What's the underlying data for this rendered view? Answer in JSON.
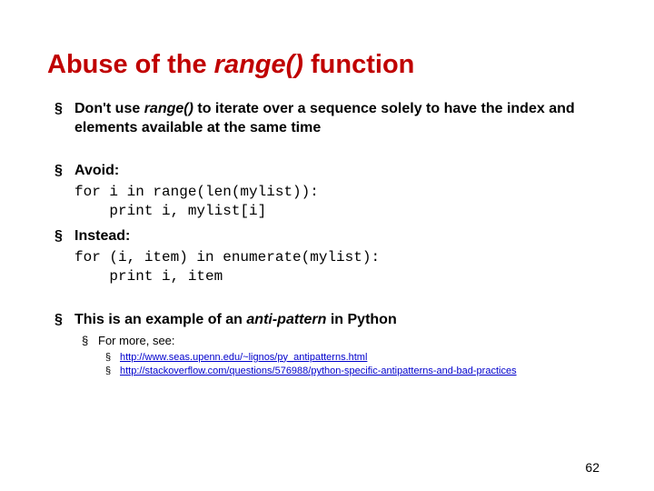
{
  "title_pre": "Abuse of the ",
  "title_fn": "range()",
  "title_post": " function",
  "bullet1_pre": "Don't use ",
  "bullet1_fn": "range()",
  "bullet1_post": " to iterate over a sequence solely to have the index and elements available at the same time",
  "avoid_label": "Avoid:",
  "avoid_code": "for i in range(len(mylist)):\n    print i, mylist[i]",
  "instead_label": "Instead:",
  "instead_code": "for (i, item) in enumerate(mylist):\n    print i, item",
  "antipattern_pre": "This is an example of an ",
  "antipattern_em": "anti-pattern",
  "antipattern_post": " in Python",
  "more_label": "For more, see:",
  "link1": "http://www.seas.upenn.edu/~lignos/py_antipatterns.html",
  "link2": "http://stackoverflow.com/questions/576988/python-specific-antipatterns-and-bad-practices",
  "page_number": "62"
}
